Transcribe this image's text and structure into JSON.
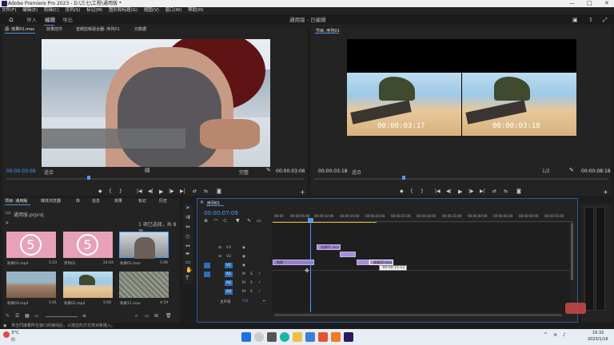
{
  "window": {
    "title": "Adobe Premiere Pro 2023 - D:\\三七\\工程\\通用版 *",
    "min": "—",
    "max": "□",
    "close": "✕"
  },
  "menu": [
    "文件(F)",
    "编辑(E)",
    "剪辑(C)",
    "序列(S)",
    "标记(M)",
    "图形和标题(G)",
    "视图(V)",
    "窗口(W)",
    "帮助(H)"
  ],
  "topbar": {
    "tabs": [
      "导入",
      "编辑",
      "导出"
    ],
    "active": "编辑",
    "center_title": "通用版 - 已编辑"
  },
  "source": {
    "tabs": [
      "源: 效果01.mov",
      "效果控件",
      "音频剪辑混合器: 序列01",
      "元数据"
    ],
    "tc_left": "00:00:03:09",
    "fit": "适合",
    "quality": "完整",
    "tc_right": "00:00:03:06"
  },
  "program": {
    "tab": "节目: 序列01",
    "tc_left": "00:00:03:18",
    "fit": "适合",
    "quality": "1/2",
    "tc_right": "00:00:08:18",
    "frame_tc_a": "00:00:03:17",
    "frame_tc_b": "00:00:03:18"
  },
  "project": {
    "tabs": [
      "项目: 通用版",
      "媒体浏览器",
      "库",
      "信息",
      "效果",
      "标记",
      "历史"
    ],
    "path": "通用版.prproj",
    "count": "1 项已选择，共 8 项",
    "items": [
      {
        "name": "效果01.mp4",
        "dur": "5:23"
      },
      {
        "name": "序列01",
        "dur": "24:04"
      },
      {
        "name": "效果01.mov",
        "dur": "5:06"
      },
      {
        "name": "效果03.mp4",
        "dur": "5:01"
      },
      {
        "name": "效果02.mp4",
        "dur": "5:00"
      },
      {
        "name": "效果11.mov",
        "dur": "4:19"
      }
    ]
  },
  "timeline": {
    "tab": "序列01",
    "tc": "00:00:07:09",
    "ruler": [
      "00:00",
      "00:00:05:00",
      "00:00:10:00",
      "00:00:15:00",
      "00:00:20:00",
      "00:00:25:00",
      "00:00:30:00",
      "00:00:35:00",
      "00:00:40:00",
      "00:00:45:00",
      "00:00:50:00",
      "00:00:55:00"
    ],
    "tracks": [
      "V3",
      "V2",
      "V1",
      "A1",
      "A2",
      "A3"
    ],
    "mix_label": "主声道",
    "mix_value": "0.0",
    "clips": [
      {
        "label": "效果01.mov",
        "track": "V2"
      },
      {
        "label": "效果",
        "track": "V1"
      },
      {
        "label": "效果01.mov",
        "track": "V1"
      },
      {
        "label": "效果02.mov",
        "track": "V1"
      }
    ],
    "tooltip": "-00:00:15:12"
  },
  "status": {
    "text": "单击同接着所在窗口的接线后，以拖拉的方式将对象拖入。"
  },
  "taskbar": {
    "weather": "3°C",
    "weather_sub": "阴",
    "time": "16:32",
    "date": "2023/1/16"
  },
  "colors": {
    "accent": "#4a9cff",
    "clip": "#a98ed8",
    "taskbar": "#e8edf3"
  }
}
